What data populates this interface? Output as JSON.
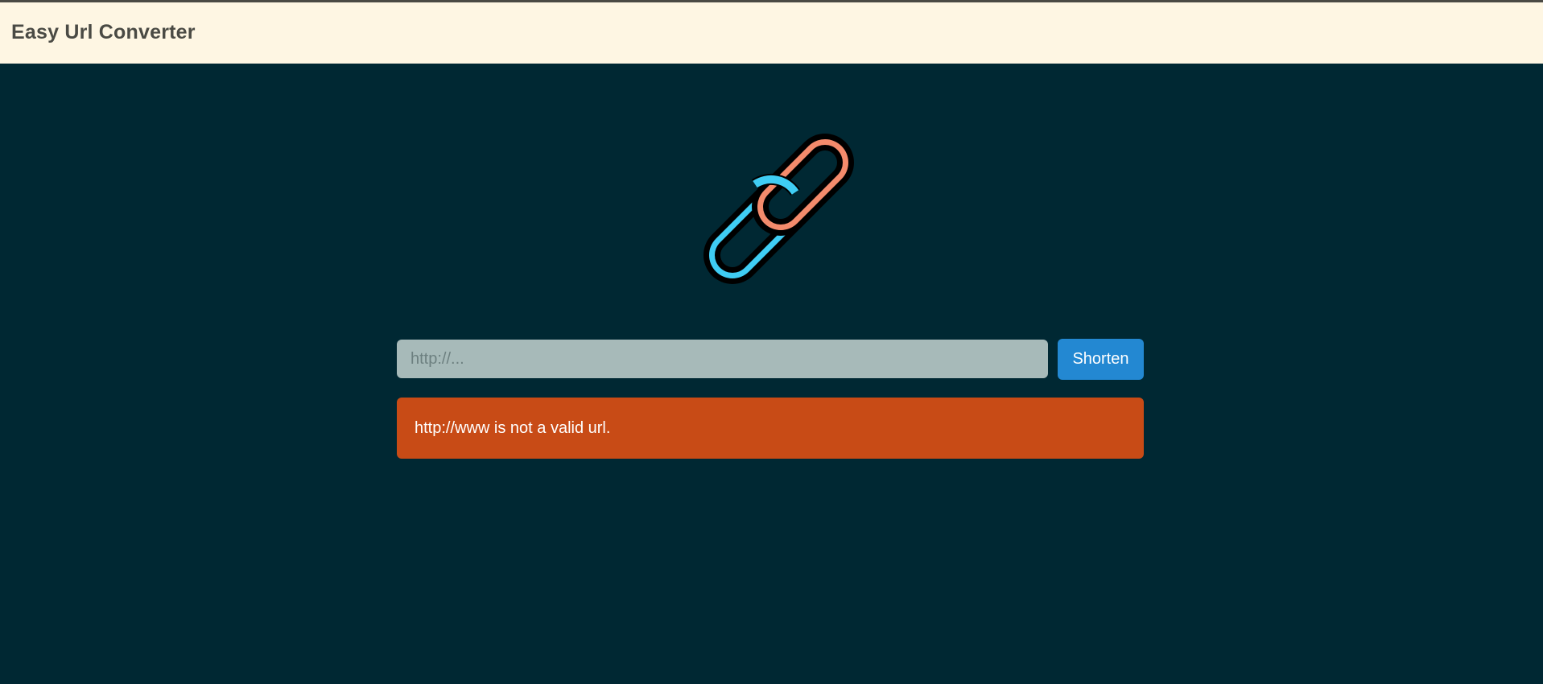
{
  "app": {
    "title": "Easy Url Converter"
  },
  "logo": {
    "icon": "chain-link-icon",
    "colors": {
      "front_link": "#f48b6c",
      "back_link": "#3fcdf4",
      "outline": "#000000"
    }
  },
  "form": {
    "url_value": "",
    "url_placeholder": "http://...",
    "submit_label": "Shorten"
  },
  "alert": {
    "message": "http://www is not a valid url.",
    "color": "#c84b16"
  },
  "colors": {
    "navbar": "#fef6e3",
    "background": "#002833",
    "input": "#a7bab9",
    "button": "#2388d2"
  }
}
